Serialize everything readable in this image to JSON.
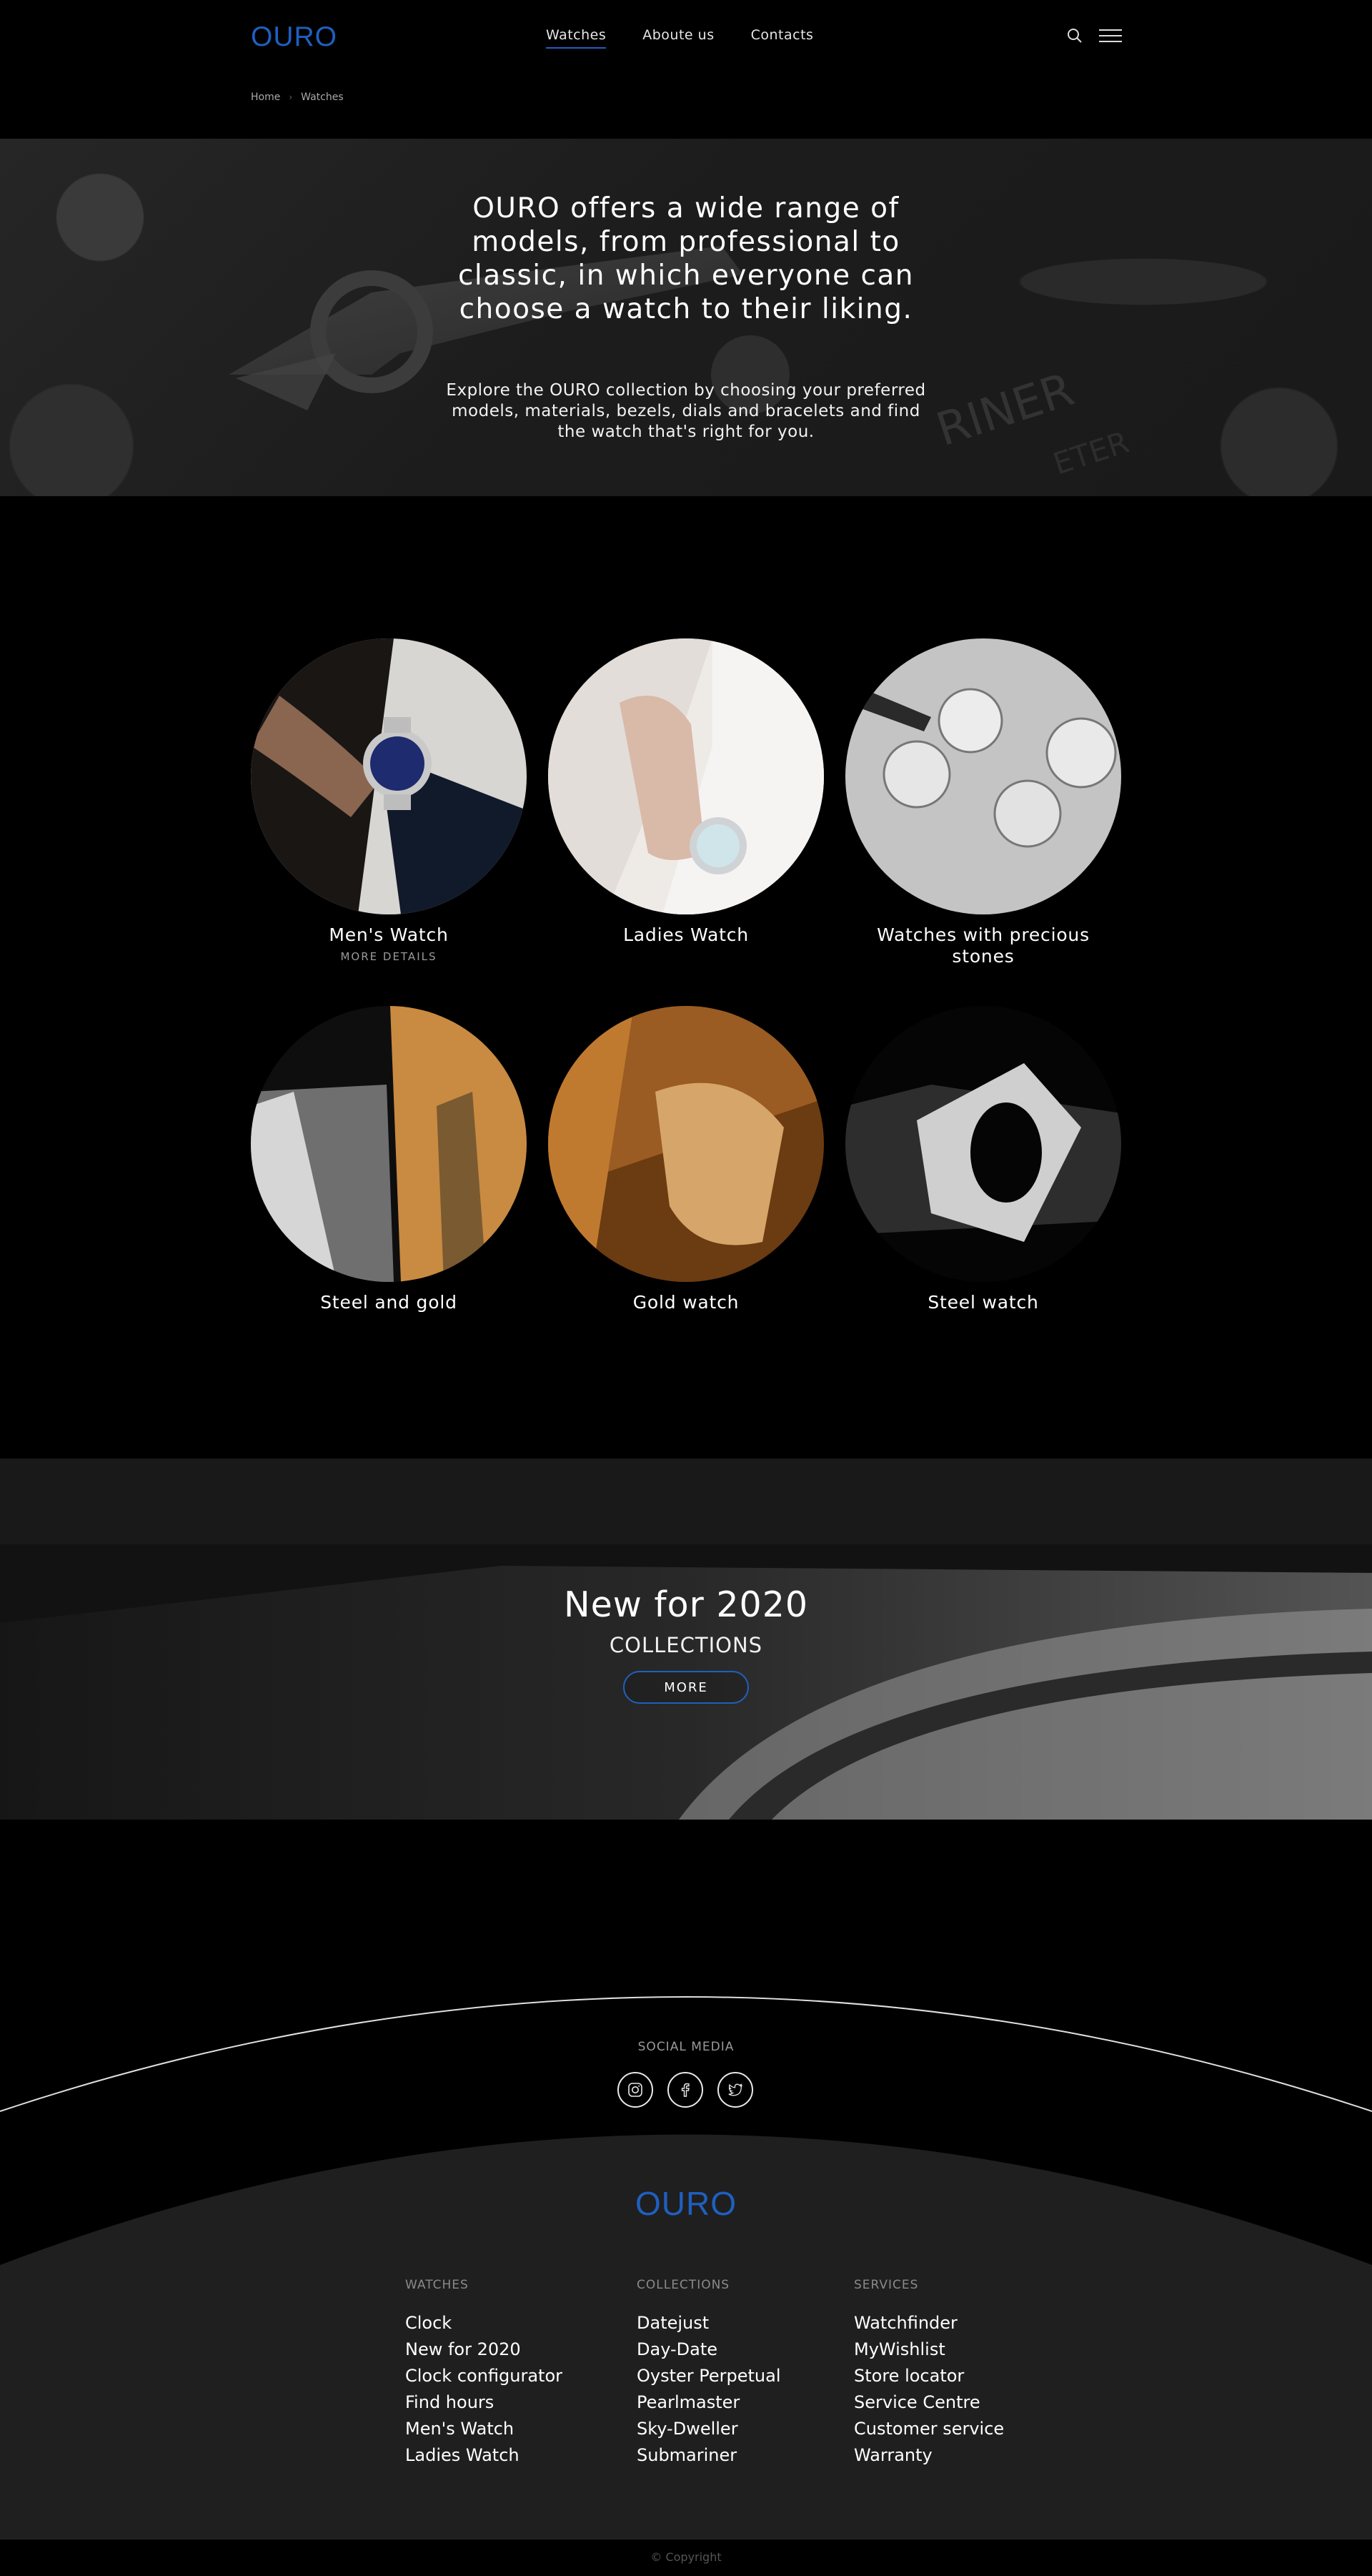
{
  "header": {
    "logo": "OURO",
    "nav": [
      {
        "label": "Watches",
        "active": true
      },
      {
        "label": "Aboute us",
        "active": false
      },
      {
        "label": "Contacts",
        "active": false
      }
    ],
    "icons": {
      "search": "search-icon",
      "menu": "menu-icon"
    }
  },
  "breadcrumb": {
    "home": "Home",
    "current": "Watches"
  },
  "hero": {
    "title": "OURO offers a wide range of models, from professional to classic, in which everyone can choose a watch to their liking.",
    "subtitle": "Explore the OURO collection by choosing your preferred models, materials, bezels, dials and bracelets and find the watch that's right for you."
  },
  "categories": [
    {
      "label": "Men's Watch",
      "more": "MORE DETAILS"
    },
    {
      "label": "Ladies Watch"
    },
    {
      "label": "Watches with precious stones"
    },
    {
      "label": "Steel and gold"
    },
    {
      "label": "Gold watch"
    },
    {
      "label": "Steel watch"
    }
  ],
  "promo": {
    "title": "New for 2020",
    "subtitle": "COLLECTIONS",
    "button": "MORE"
  },
  "social": {
    "title": "SOCIAL MEDIA",
    "icons": [
      "instagram-icon",
      "facebook-icon",
      "twitter-icon"
    ]
  },
  "footer": {
    "logo": "OURO",
    "columns": [
      {
        "title": "WATCHES",
        "links": [
          "Clock",
          "New for 2020",
          "Clock configurator",
          "Find hours",
          "Men's Watch",
          "Ladies Watch"
        ]
      },
      {
        "title": "COLLECTIONS",
        "links": [
          "Datejust",
          "Day-Date",
          "Oyster Perpetual",
          "Pearlmaster",
          "Sky-Dweller",
          "Submariner"
        ]
      },
      {
        "title": "SERVICES",
        "links": [
          "Watchfinder",
          "MyWishlist",
          "Store locator",
          "Service Centre",
          "Customer service",
          "Warranty"
        ]
      }
    ],
    "copyright": "© Copyright"
  },
  "colors": {
    "accent": "#1f5fbf",
    "background": "#000000",
    "footer_bg": "#1f1f1f"
  }
}
